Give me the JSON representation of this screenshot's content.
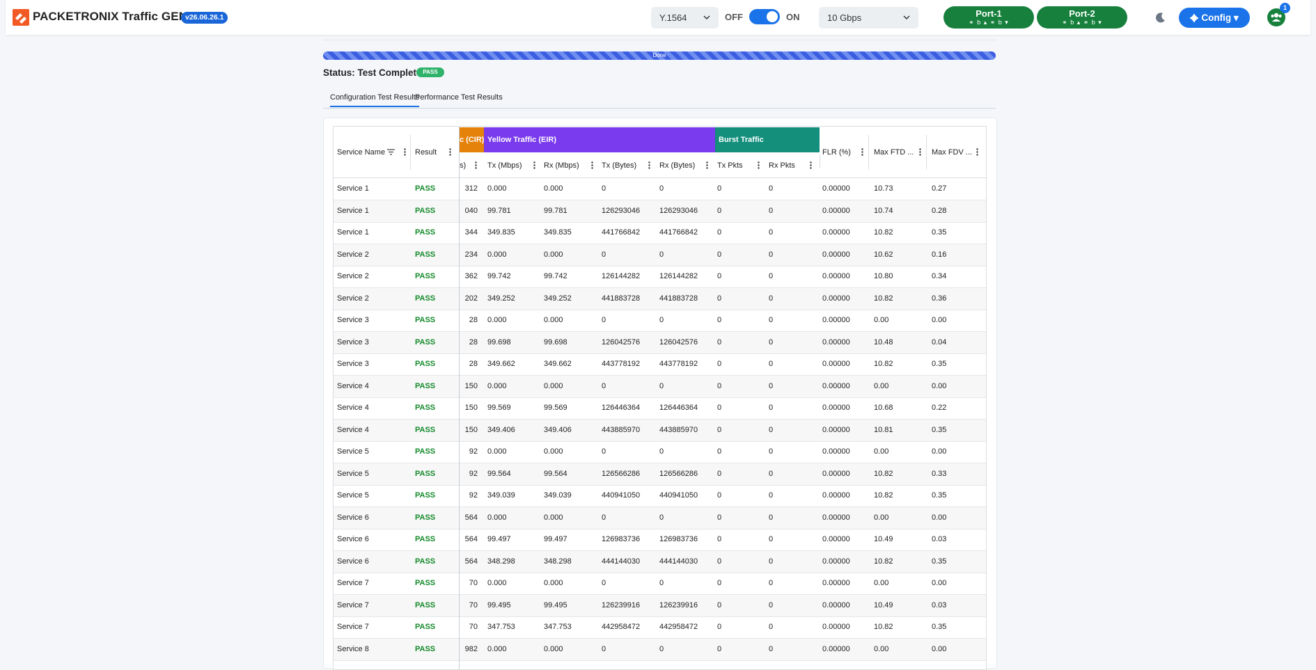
{
  "app": {
    "brand": "PACKETRONIX Traffic GEN",
    "version": "v26.06.26.1",
    "test_type": "Y.1564",
    "toggle_off": "OFF",
    "toggle_on": "ON",
    "speed": "10 Gbps",
    "ports": [
      {
        "name": "Port-1",
        "status": "⚭ b ▴   ⚭ b ▾"
      },
      {
        "name": "Port-2",
        "status": "⚭ b ▴   ⚭ b ▾"
      }
    ],
    "config_label": "Config",
    "users_badge": "1",
    "accent": "#1a73e8"
  },
  "progress": {
    "label": "Done",
    "fraction": 1.0
  },
  "status": {
    "text": "Status: Test Complete",
    "badge": "PASS"
  },
  "tabs": [
    "Configuration Test Results",
    "Performance Test Results"
  ],
  "grid": {
    "groups": [
      {
        "label": "c (CIR)",
        "color": "#e5820a"
      },
      {
        "label": "Yellow Traffic (EIR)",
        "color": "#7a3aed"
      },
      {
        "label": "Burst Traffic",
        "color": "#138f7c"
      }
    ],
    "headers": {
      "service_name": "Service Name",
      "result": "Result",
      "clipped": "s)",
      "tx_mbps": "Tx (Mbps)",
      "rx_mbps": "Rx (Mbps)",
      "tx_bytes": "Tx (Bytes)",
      "rx_bytes": "Rx (Bytes)",
      "tx_pkts": "Tx Pkts",
      "rx_pkts": "Rx Pkts",
      "flr": "FLR (%)",
      "max_ftd": "Max FTD ...",
      "max_fdv": "Max FDV ..."
    },
    "rows": [
      {
        "service": "Service 1",
        "result": "PASS",
        "clip": "312",
        "tx": "0.000",
        "rx": "0.000",
        "txb": "0",
        "rxb": "0",
        "txp": "0",
        "rxp": "0",
        "flr": "0.00000",
        "ftd": "10.73",
        "fdv": "0.27"
      },
      {
        "service": "Service 1",
        "result": "PASS",
        "clip": "040",
        "tx": "99.781",
        "rx": "99.781",
        "txb": "126293046",
        "rxb": "126293046",
        "txp": "0",
        "rxp": "0",
        "flr": "0.00000",
        "ftd": "10.74",
        "fdv": "0.28"
      },
      {
        "service": "Service 1",
        "result": "PASS",
        "clip": "344",
        "tx": "349.835",
        "rx": "349.835",
        "txb": "441766842",
        "rxb": "441766842",
        "txp": "0",
        "rxp": "0",
        "flr": "0.00000",
        "ftd": "10.82",
        "fdv": "0.35"
      },
      {
        "service": "Service 2",
        "result": "PASS",
        "clip": "234",
        "tx": "0.000",
        "rx": "0.000",
        "txb": "0",
        "rxb": "0",
        "txp": "0",
        "rxp": "0",
        "flr": "0.00000",
        "ftd": "10.62",
        "fdv": "0.16"
      },
      {
        "service": "Service 2",
        "result": "PASS",
        "clip": "362",
        "tx": "99.742",
        "rx": "99.742",
        "txb": "126144282",
        "rxb": "126144282",
        "txp": "0",
        "rxp": "0",
        "flr": "0.00000",
        "ftd": "10.80",
        "fdv": "0.34"
      },
      {
        "service": "Service 2",
        "result": "PASS",
        "clip": "202",
        "tx": "349.252",
        "rx": "349.252",
        "txb": "441883728",
        "rxb": "441883728",
        "txp": "0",
        "rxp": "0",
        "flr": "0.00000",
        "ftd": "10.82",
        "fdv": "0.36"
      },
      {
        "service": "Service 3",
        "result": "PASS",
        "clip": "28",
        "tx": "0.000",
        "rx": "0.000",
        "txb": "0",
        "rxb": "0",
        "txp": "0",
        "rxp": "0",
        "flr": "0.00000",
        "ftd": "0.00",
        "fdv": "0.00"
      },
      {
        "service": "Service 3",
        "result": "PASS",
        "clip": "28",
        "tx": "99.698",
        "rx": "99.698",
        "txb": "126042576",
        "rxb": "126042576",
        "txp": "0",
        "rxp": "0",
        "flr": "0.00000",
        "ftd": "10.48",
        "fdv": "0.04"
      },
      {
        "service": "Service 3",
        "result": "PASS",
        "clip": "28",
        "tx": "349.662",
        "rx": "349.662",
        "txb": "443778192",
        "rxb": "443778192",
        "txp": "0",
        "rxp": "0",
        "flr": "0.00000",
        "ftd": "10.82",
        "fdv": "0.35"
      },
      {
        "service": "Service 4",
        "result": "PASS",
        "clip": "150",
        "tx": "0.000",
        "rx": "0.000",
        "txb": "0",
        "rxb": "0",
        "txp": "0",
        "rxp": "0",
        "flr": "0.00000",
        "ftd": "0.00",
        "fdv": "0.00"
      },
      {
        "service": "Service 4",
        "result": "PASS",
        "clip": "150",
        "tx": "99.569",
        "rx": "99.569",
        "txb": "126446364",
        "rxb": "126446364",
        "txp": "0",
        "rxp": "0",
        "flr": "0.00000",
        "ftd": "10.68",
        "fdv": "0.22"
      },
      {
        "service": "Service 4",
        "result": "PASS",
        "clip": "150",
        "tx": "349.406",
        "rx": "349.406",
        "txb": "443885970",
        "rxb": "443885970",
        "txp": "0",
        "rxp": "0",
        "flr": "0.00000",
        "ftd": "10.81",
        "fdv": "0.35"
      },
      {
        "service": "Service 5",
        "result": "PASS",
        "clip": "92",
        "tx": "0.000",
        "rx": "0.000",
        "txb": "0",
        "rxb": "0",
        "txp": "0",
        "rxp": "0",
        "flr": "0.00000",
        "ftd": "0.00",
        "fdv": "0.00"
      },
      {
        "service": "Service 5",
        "result": "PASS",
        "clip": "92",
        "tx": "99.564",
        "rx": "99.564",
        "txb": "126566286",
        "rxb": "126566286",
        "txp": "0",
        "rxp": "0",
        "flr": "0.00000",
        "ftd": "10.82",
        "fdv": "0.33"
      },
      {
        "service": "Service 5",
        "result": "PASS",
        "clip": "92",
        "tx": "349.039",
        "rx": "349.039",
        "txb": "440941050",
        "rxb": "440941050",
        "txp": "0",
        "rxp": "0",
        "flr": "0.00000",
        "ftd": "10.82",
        "fdv": "0.35"
      },
      {
        "service": "Service 6",
        "result": "PASS",
        "clip": "564",
        "tx": "0.000",
        "rx": "0.000",
        "txb": "0",
        "rxb": "0",
        "txp": "0",
        "rxp": "0",
        "flr": "0.00000",
        "ftd": "0.00",
        "fdv": "0.00"
      },
      {
        "service": "Service 6",
        "result": "PASS",
        "clip": "564",
        "tx": "99.497",
        "rx": "99.497",
        "txb": "126983736",
        "rxb": "126983736",
        "txp": "0",
        "rxp": "0",
        "flr": "0.00000",
        "ftd": "10.49",
        "fdv": "0.03"
      },
      {
        "service": "Service 6",
        "result": "PASS",
        "clip": "564",
        "tx": "348.298",
        "rx": "348.298",
        "txb": "444144030",
        "rxb": "444144030",
        "txp": "0",
        "rxp": "0",
        "flr": "0.00000",
        "ftd": "10.82",
        "fdv": "0.35"
      },
      {
        "service": "Service 7",
        "result": "PASS",
        "clip": "70",
        "tx": "0.000",
        "rx": "0.000",
        "txb": "0",
        "rxb": "0",
        "txp": "0",
        "rxp": "0",
        "flr": "0.00000",
        "ftd": "0.00",
        "fdv": "0.00"
      },
      {
        "service": "Service 7",
        "result": "PASS",
        "clip": "70",
        "tx": "99.495",
        "rx": "99.495",
        "txb": "126239916",
        "rxb": "126239916",
        "txp": "0",
        "rxp": "0",
        "flr": "0.00000",
        "ftd": "10.49",
        "fdv": "0.03"
      },
      {
        "service": "Service 7",
        "result": "PASS",
        "clip": "70",
        "tx": "347.753",
        "rx": "347.753",
        "txb": "442958472",
        "rxb": "442958472",
        "txp": "0",
        "rxp": "0",
        "flr": "0.00000",
        "ftd": "10.82",
        "fdv": "0.35"
      },
      {
        "service": "Service 8",
        "result": "PASS",
        "clip": "982",
        "tx": "0.000",
        "rx": "0.000",
        "txb": "0",
        "rxb": "0",
        "txp": "0",
        "rxp": "0",
        "flr": "0.00000",
        "ftd": "0.00",
        "fdv": "0.00"
      }
    ]
  }
}
